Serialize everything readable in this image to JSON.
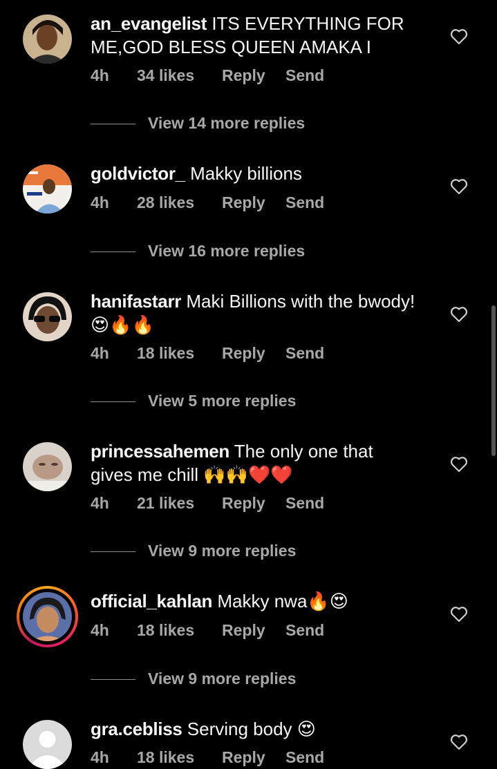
{
  "comments": [
    {
      "username": "an_evangelist",
      "text": "ITS EVERYTHING FOR ME,GOD BLESS QUEEN AMAKA I",
      "time": "4h",
      "likes": "34 likes",
      "reply": "Reply",
      "send": "Send",
      "view_replies": "View 14 more replies"
    },
    {
      "username": "goldvictor_",
      "text": "Makky billions",
      "time": "4h",
      "likes": "28 likes",
      "reply": "Reply",
      "send": "Send",
      "view_replies": "View 16 more replies"
    },
    {
      "username": "hanifastarr",
      "text": "Maki Billions with the bwody! 😍🔥🔥",
      "time": "4h",
      "likes": "18 likes",
      "reply": "Reply",
      "send": "Send",
      "view_replies": "View 5 more replies"
    },
    {
      "username": "princessahemen",
      "text": "The only one that gives me chill 🙌🙌❤️❤️",
      "time": "4h",
      "likes": "21 likes",
      "reply": "Reply",
      "send": "Send",
      "view_replies": "View 9 more replies"
    },
    {
      "username": "official_kahlan",
      "text": "Makky nwa🔥😍",
      "time": "4h",
      "likes": "18 likes",
      "reply": "Reply",
      "send": "Send",
      "view_replies": "View 9 more replies"
    },
    {
      "username": "gra.cebliss",
      "text": "Serving body 😍",
      "time": "4h",
      "likes": "18 likes",
      "reply": "Reply",
      "send": "Send"
    }
  ],
  "colors": {
    "background": "#000000",
    "primary_text": "#f5f5f5",
    "secondary_text": "#a8a8a8",
    "story_ring": "#e91e63"
  },
  "icons": [
    "heart-icon",
    "avatar-placeholder-icon"
  ]
}
